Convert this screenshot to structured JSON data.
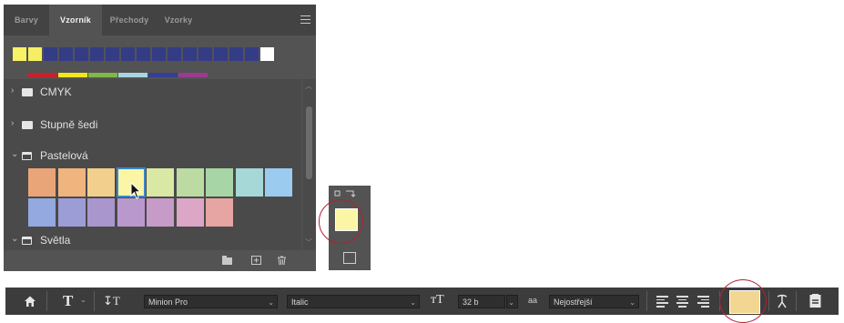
{
  "swatches_panel": {
    "tabs": [
      {
        "label": "Barvy",
        "active": false
      },
      {
        "label": "Vzorník",
        "active": true
      },
      {
        "label": "Přechody",
        "active": false
      },
      {
        "label": "Vzorky",
        "active": false
      }
    ],
    "recent_swatches": [
      "#f8f266",
      "#f5ee63",
      "#343c86",
      "#343c86",
      "#343c86",
      "#343c86",
      "#343c86",
      "#343c86",
      "#343c86",
      "#343c86",
      "#343c86",
      "#343c86",
      "#343c86",
      "#343c86",
      "#343c86",
      "#343c86",
      "#ffffff"
    ],
    "ribbon_colors": [
      "#c8202d",
      "#f2e51b",
      "#7fb846",
      "#a8d5e0",
      "#344096",
      "#9c3a8f"
    ],
    "groups": [
      {
        "label": "CMYK",
        "expanded": false
      },
      {
        "label": "Stupně šedi",
        "expanded": false
      },
      {
        "label": "Pastelová",
        "expanded": true
      },
      {
        "label": "Světla",
        "expanded": true
      }
    ],
    "pastel_swatches_row1": [
      "#e9a577",
      "#f0b47f",
      "#f2cf8c",
      "#fbf6a6",
      "#d9e8a4",
      "#bcdba2",
      "#a8d5a5",
      "#a5d8d6",
      "#9ccbf0"
    ],
    "pastel_swatches_row2": [
      "#93a9e0",
      "#9c9dd7",
      "#a996cd",
      "#b898cd",
      "#c79bc8",
      "#dca6c7",
      "#e6a4a3"
    ],
    "selected_swatch_index": 3,
    "bottom_icons": [
      "new-group-folder-icon",
      "new-swatch-icon",
      "delete-swatch-icon"
    ]
  },
  "tools_widget": {
    "fill_color": "#fbf6a6"
  },
  "control_bar": {
    "font_family": "Minion Pro",
    "font_style": "Italic",
    "font_size": "32 b",
    "aa_label": "aa",
    "antialias": "Nejostřejší",
    "text_color": "#f3d691"
  },
  "accent": {
    "highlight_ring": "#b52030",
    "selection_blue": "#3b87c9"
  }
}
